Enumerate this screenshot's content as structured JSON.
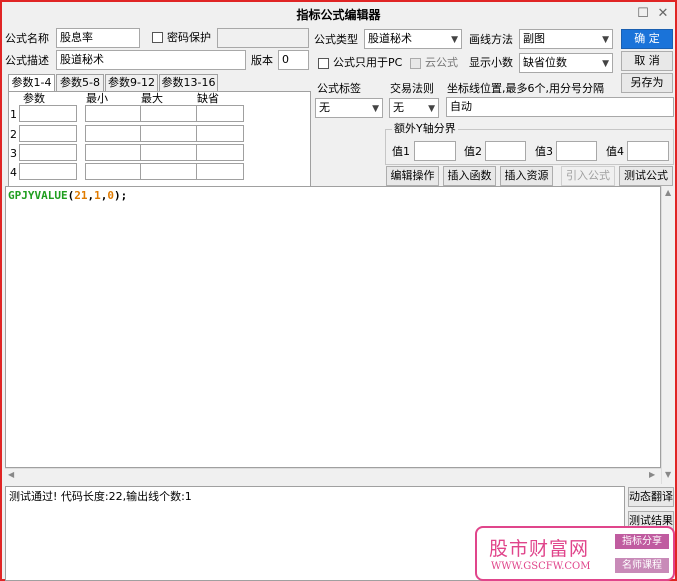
{
  "window": {
    "title": "指标公式编辑器"
  },
  "form": {
    "name_label": "公式名称",
    "name_value": "股息率",
    "password_label": "密码保护",
    "desc_label": "公式描述",
    "desc_value": "股道秘术",
    "version_label": "版本",
    "version_value": "0",
    "type_label": "公式类型",
    "type_value": "股道秘术",
    "draw_label": "画线方法",
    "draw_value": "副图",
    "pc_only_label": "公式只用于PC",
    "cloud_label": "云公式",
    "decimals_label": "显示小数",
    "decimals_value": "缺省位数"
  },
  "buttons": {
    "ok": "确 定",
    "cancel": "取 消",
    "save_as": "另存为",
    "edit_ops": "编辑操作",
    "insert_func": "插入函数",
    "insert_res": "插入资源",
    "import_formula": "引入公式",
    "test_formula": "测试公式",
    "dynamic_translate": "动态翻译",
    "test_result": "测试结果"
  },
  "tabs": [
    "参数1-4",
    "参数5-8",
    "参数9-12",
    "参数13-16"
  ],
  "params": {
    "headers": [
      "参数",
      "最小",
      "最大",
      "缺省"
    ],
    "rows": [
      "1",
      "2",
      "3",
      "4"
    ]
  },
  "tag": {
    "label": "公式标签",
    "value": "无"
  },
  "trade_rule": {
    "label": "交易法则",
    "value": "无"
  },
  "axis": {
    "label": "坐标线位置,最多6个,用分号分隔",
    "value": "自动"
  },
  "extra_y": {
    "label": "额外Y轴分界",
    "v1": "值1",
    "v2": "值2",
    "v3": "值3",
    "v4": "值4"
  },
  "code": {
    "func": "GPJYVALUE",
    "open": "(",
    "a1": "21",
    "c1": ",",
    "a2": "1",
    "c2": ",",
    "a3": "0",
    "close": ");",
    "colors": {
      "func": "#1f9e1f",
      "num": "#e07b00",
      "punct": "#000000"
    }
  },
  "status": {
    "text": "测试通过! 代码长度:22,输出线个数:1"
  },
  "watermark": {
    "brand": "股市财富网",
    "url": "WWW.GSCFW.COM",
    "tag1": "指标分享",
    "tag2": "名师课程"
  }
}
